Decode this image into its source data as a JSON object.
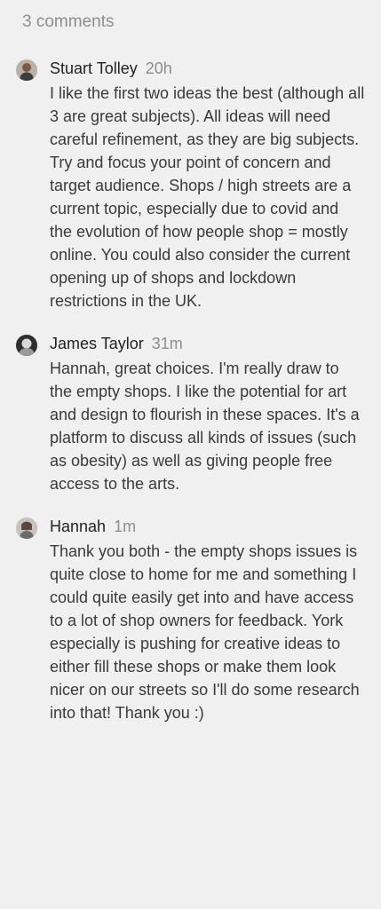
{
  "comments_header": {
    "count_label": "3 comments"
  },
  "comments": [
    {
      "author": "Stuart Tolley",
      "time": "20h",
      "text": "I like the first two ideas the best (although all 3 are great subjects). All ideas will need careful refinement, as they are big subjects. Try and focus your point of concern and target audience. Shops / high streets are a current topic, especially due to covid and the evolution of how people shop = mostly online. You could also consider the current opening up of shops and lockdown restrictions in the UK.",
      "avatar_icon": "user-photo-icon"
    },
    {
      "author": "James Taylor",
      "time": "31m",
      "text": "Hannah, great choices. I'm really draw to the empty shops. I like the potential for art and design to flourish in these spaces. It's a platform to discuss all kinds of issues (such as obesity) as well as giving people free access to the arts.",
      "avatar_icon": "user-photo-icon"
    },
    {
      "author": "Hannah",
      "time": "1m",
      "text": "Thank you both - the empty shops issues is quite close to home for me and something I could quite easily get into and have access to a lot of shop owners for feedback. York especially is pushing for creative ideas to either fill these shops or make them look nicer on our streets so I'll do some research into that! Thank you :)",
      "avatar_icon": "user-photo-icon"
    }
  ],
  "colors": {
    "background": "#f0f0f0",
    "muted_text": "#8e8e8e",
    "body_text": "#3a3a3a",
    "author_text": "#222222"
  }
}
